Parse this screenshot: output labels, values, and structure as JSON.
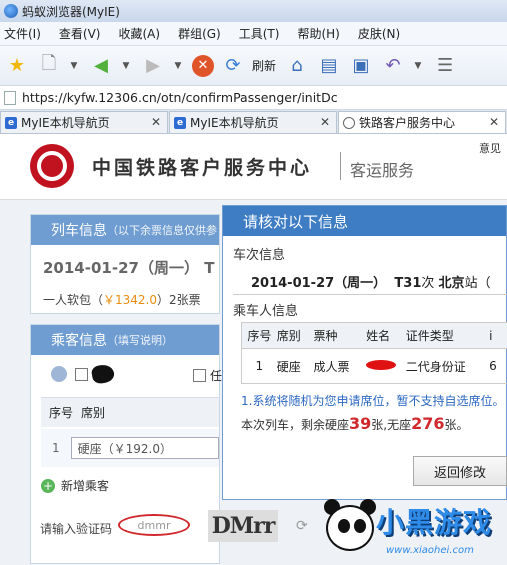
{
  "window": {
    "title": "蚂蚁浏览器(MyIE)"
  },
  "menu": [
    "文件(I)",
    "查看(V)",
    "收藏(A)",
    "群组(G)",
    "工具(T)",
    "帮助(H)",
    "皮肤(N)"
  ],
  "toolbar": {
    "refresh_label": "刷新"
  },
  "address": {
    "url": "https://kyfw.12306.cn/otn/confirmPassenger/initDc"
  },
  "tabs": [
    {
      "label": "MyIE本机导航页"
    },
    {
      "label": "MyIE本机导航页"
    },
    {
      "label": "铁路客户服务中心"
    }
  ],
  "site": {
    "title": "中国铁路客户服务中心",
    "subtitle": "客运服务",
    "top_right": "意见"
  },
  "train_panel": {
    "header": "列车信息",
    "header_note": "（以下余票信息仅供参",
    "date": "2014-01-27（周一）",
    "train_prefix": "T",
    "seat_prefix": "一人软包（",
    "seat_price": "￥1342.0",
    "seat_suffix": "）2张票"
  },
  "passenger_panel": {
    "header": "乘客信息",
    "header_note": "（填写说明）",
    "ren_label": "任",
    "col_no": "序号",
    "col_seat": "席别",
    "row_no": "1",
    "row_seat": "硬座（￥192.0）",
    "add_label": "新增乘客",
    "captcha_label": "请输入验证码",
    "captcha_placeholder": "dmmr",
    "captcha_image_text": "DMrr"
  },
  "modal": {
    "title": "请核对以下信息",
    "train_section": "车次信息",
    "date": "2014-01-27（周一）",
    "train_no": "T31",
    "train_suffix": "次",
    "station": "北京",
    "station_suffix": "站（",
    "passenger_section": "乘车人信息",
    "columns": [
      "序号",
      "席别",
      "票种",
      "姓名",
      "证件类型",
      "i"
    ],
    "row": {
      "no": "1",
      "seat": "硬座",
      "ticket": "成人票",
      "id_type": "二代身份证",
      "extra": "6"
    },
    "note1": "1.系统将随机为您申请席位，暂不支持自选席位。",
    "note2_prefix": "本次列车，剩余硬座",
    "hard_seat": "39",
    "note2_mid": "张,无座",
    "no_seat": "276",
    "note2_suffix": "张。",
    "back_button": "返回修改"
  },
  "watermark": {
    "text": "小黑游戏",
    "url": "www.xiaohei.com"
  }
}
